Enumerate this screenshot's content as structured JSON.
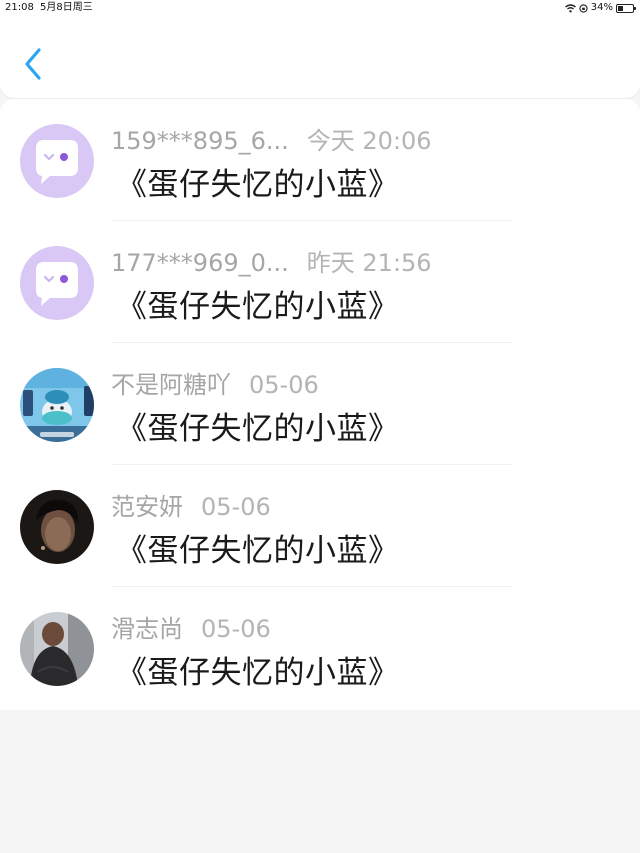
{
  "status_bar": {
    "time": "21:08",
    "date": "5月8日周三",
    "battery": "34%"
  },
  "header": {
    "back_icon": "chevron-left-icon",
    "accent_color": "#2aa5f0"
  },
  "comments": [
    {
      "avatar": "default-chat-avatar",
      "name": "159***895_6...",
      "time": "今天 20:06",
      "text": "《蛋仔失忆的小蓝》"
    },
    {
      "avatar": "default-chat-avatar",
      "name": "177***969_0...",
      "time": "昨天 21:56",
      "text": "《蛋仔失忆的小蓝》"
    },
    {
      "avatar": "game-character-avatar",
      "name": "不是阿糖吖",
      "time": "05-06",
      "text": "《蛋仔失忆的小蓝》"
    },
    {
      "avatar": "portrait-avatar",
      "name": "范安妍",
      "time": "05-06",
      "text": "《蛋仔失忆的小蓝》"
    },
    {
      "avatar": "photo-avatar",
      "name": "滑志尚",
      "time": "05-06",
      "text": "《蛋仔失忆的小蓝》"
    }
  ]
}
